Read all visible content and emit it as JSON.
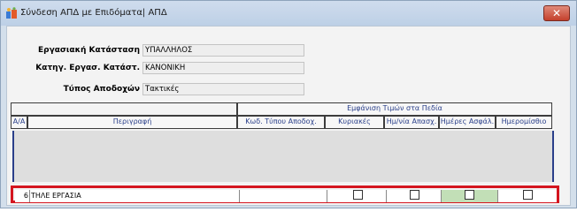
{
  "window": {
    "title": "Σύνδεση ΑΠΔ με Επιδόματα| ΑΠΔ",
    "close_glyph": "✕"
  },
  "form": {
    "employment_status_label": "Εργασιακή Κατάσταση",
    "employment_status_value": "ΥΠΑΛΛΗΛΟΣ",
    "employment_category_label": "Κατηγ. Εργασ. Κατάστ.",
    "employment_category_value": "ΚΑΝΟΝΙΚΗ",
    "earnings_type_label": "Τύπος Αποδοχών",
    "earnings_type_value": "Τακτικές"
  },
  "grid": {
    "group_header": "Εμφάνιση Τιμών στα Πεδία",
    "columns": {
      "aa": "Α/Α",
      "description": "Περιγραφή",
      "earnings_code": "Κωδ. Τύπου Αποδοχ.",
      "sundays": "Κυριακές",
      "holidays": "Ημ/νία Απασχ.",
      "insurance_days": "Ημέρες Ασφάλ.",
      "daily_wage": "Ημερομίσθιο"
    },
    "rows": [
      {
        "aa": "6",
        "description": "ΤΗΛΕ ΕΡΓΑΣΙΑ",
        "earnings_code": "",
        "sundays": false,
        "holidays": false,
        "insurance_days": false,
        "daily_wage": false
      }
    ]
  },
  "colors": {
    "highlight_border": "#d4151f",
    "selected_cell": "#c2dfb7",
    "accent": "#2a3f8a"
  }
}
